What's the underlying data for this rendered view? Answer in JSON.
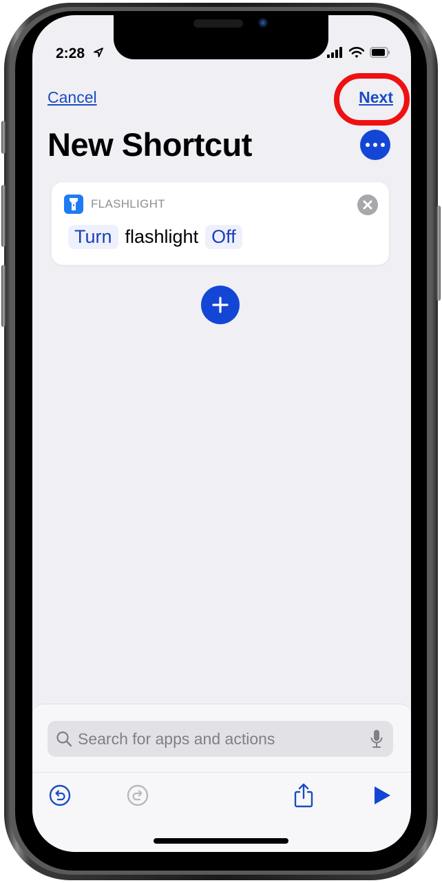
{
  "status_bar": {
    "time": "2:28",
    "location_icon": "location-arrow-icon",
    "signal_icon": "cellular-signal-icon",
    "wifi_icon": "wifi-icon",
    "battery_icon": "battery-icon"
  },
  "nav": {
    "cancel_label": "Cancel",
    "next_label": "Next",
    "next_highlighted": true,
    "highlight_color": "#ee1111"
  },
  "header": {
    "title": "New Shortcut",
    "more_icon": "ellipsis-icon"
  },
  "actions": [
    {
      "app_name": "FLASHLIGHT",
      "app_icon": "flashlight-icon",
      "app_color": "#1f7bf5",
      "verb": "Turn",
      "object": "flashlight",
      "state": "Off",
      "remove_icon": "close-icon"
    }
  ],
  "add_action_icon": "plus-icon",
  "search": {
    "placeholder": "Search for apps and actions",
    "value": ""
  },
  "toolbar": {
    "undo_icon": "undo-icon",
    "redo_icon": "redo-icon",
    "redo_enabled": false,
    "share_icon": "share-icon",
    "run_icon": "play-icon"
  },
  "colors": {
    "accent": "#1446d6",
    "link": "#1a4bc4",
    "background": "#efeff4"
  }
}
